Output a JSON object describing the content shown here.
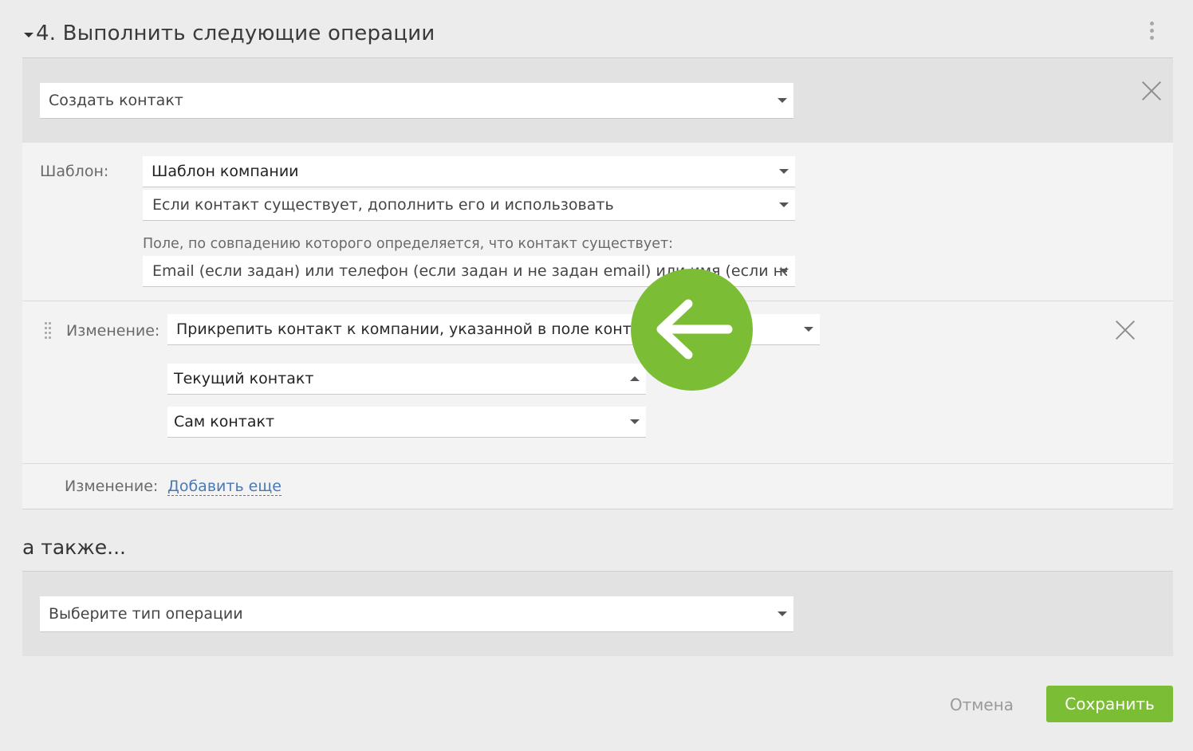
{
  "header": {
    "title": "4. Выполнить следующие операции"
  },
  "operation": {
    "type_value": "Создать контакт"
  },
  "template": {
    "label": "Шаблон:",
    "value": "Шаблон компании",
    "existing_mode": "Если контакт существует, дополнить его и использовать",
    "match_field_label": "Поле, по совпадению которого определяется, что контакт существует:",
    "match_field_value": "Email (если задан) или телефон (если задан и не задан email) или имя (если не заданы"
  },
  "change": {
    "label": "Изменение:",
    "value": "Прикрепить контакт к компании, указанной в поле контакта",
    "sub_select_1": "Текущий контакт",
    "sub_select_2": "Сам контакт"
  },
  "add_change": {
    "label": "Изменение:",
    "link": "Добавить еще"
  },
  "also": {
    "heading": "а также...",
    "placeholder": "Выберите тип операции"
  },
  "footer": {
    "cancel_label": "Отмена",
    "save_label": "Сохранить"
  },
  "colors": {
    "accent": "#7cbd36",
    "link": "#4a79b4"
  }
}
